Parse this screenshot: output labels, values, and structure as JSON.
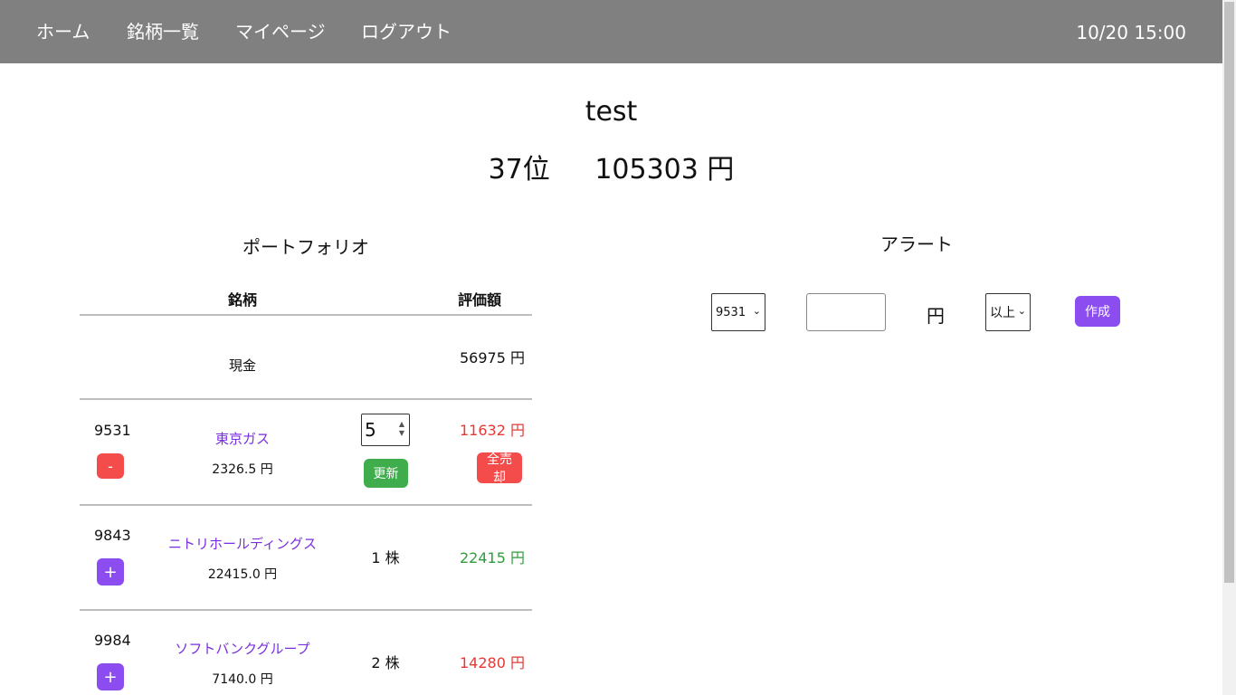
{
  "nav": {
    "home": "ホーム",
    "stocks": "銘柄一覧",
    "mypage": "マイページ",
    "logout": "ログアウト",
    "datetime": "10/20 15:00"
  },
  "user": {
    "name": "test",
    "rank": "37位",
    "total": "105303 円"
  },
  "portfolio": {
    "title": "ポートフォリオ",
    "headers": {
      "stock": "銘柄",
      "value": "評価額"
    },
    "cash": {
      "label": "現金",
      "value": "56975 円"
    },
    "rows": [
      {
        "code": "9531",
        "name": "東京ガス",
        "price": "2326.5 円",
        "qty": "5",
        "value": "11632 円",
        "action": "-",
        "update": "更新",
        "sell_all": "全売却"
      },
      {
        "code": "9843",
        "name": "ニトリホールディングス",
        "price": "22415.0 円",
        "qty": "1 株",
        "value": "22415 円",
        "action": "+"
      },
      {
        "code": "9984",
        "name": "ソフトバンクグループ",
        "price": "7140.0 円",
        "qty": "2 株",
        "value": "14280 円",
        "action": "+"
      }
    ]
  },
  "alert": {
    "title": "アラート",
    "code_selected": "9531",
    "price_placeholder": "",
    "unit": "円",
    "condition_selected": "以上",
    "create_label": "作成"
  },
  "colors": {
    "navbar": "#808080",
    "accent_purple": "#8b4cf0",
    "sell_red": "#f44b4b",
    "update_green": "#3fad4c",
    "loss": "#e53935",
    "gain": "#2e9e3a"
  }
}
